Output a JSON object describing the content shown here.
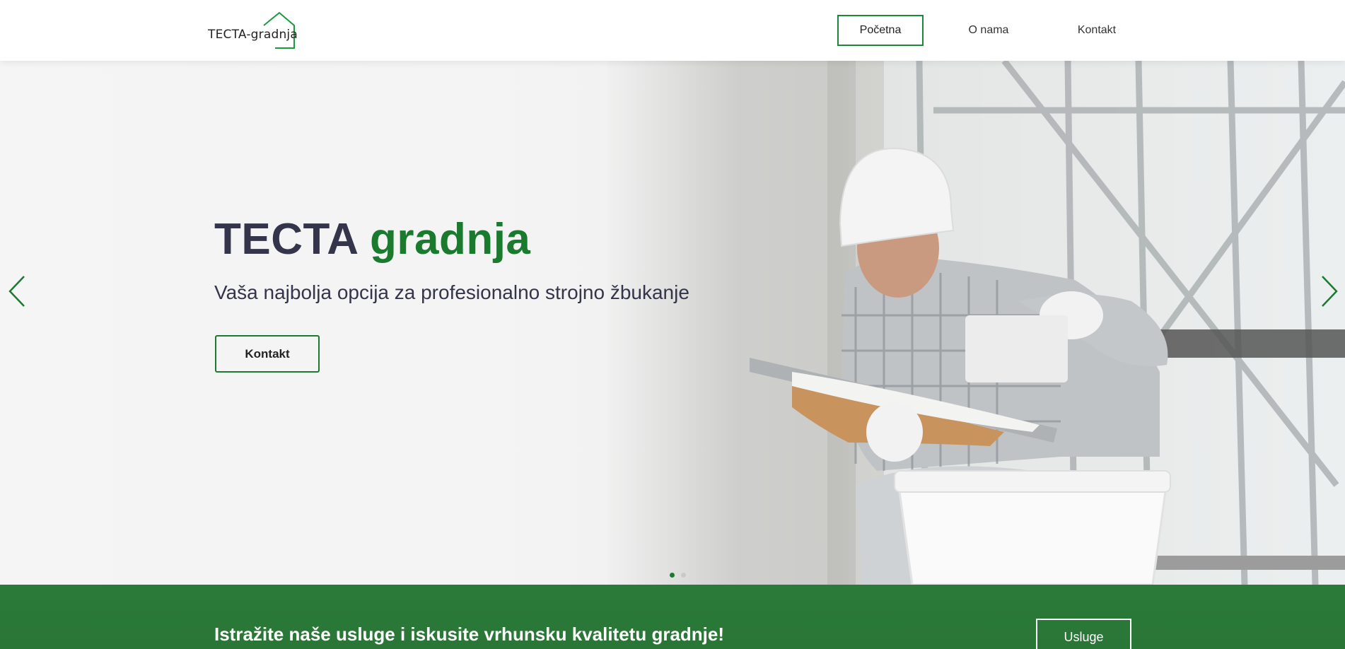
{
  "header": {
    "logo_text": "TECTA-gradnja",
    "nav": [
      {
        "label": "Početna",
        "active": true
      },
      {
        "label": "O nama",
        "active": false
      },
      {
        "label": "Kontakt",
        "active": false
      }
    ]
  },
  "hero": {
    "title_part1": "TECTA",
    "title_part2": "gradnja",
    "subtitle": "Vaša najbolja opcija za profesionalno strojno žbukanje",
    "button_label": "Kontakt",
    "prev_icon": "chevron-left-icon",
    "next_icon": "chevron-right-icon",
    "slides_total": 2,
    "active_slide": 1
  },
  "band": {
    "text": "Istražite naše usluge i iskusite vrhunsku kvalitetu gradnje!",
    "button_label": "Usluge"
  },
  "colors": {
    "brand_green": "#1a7a2e",
    "band_green": "#2b7a39",
    "text_dark": "#34344a"
  }
}
